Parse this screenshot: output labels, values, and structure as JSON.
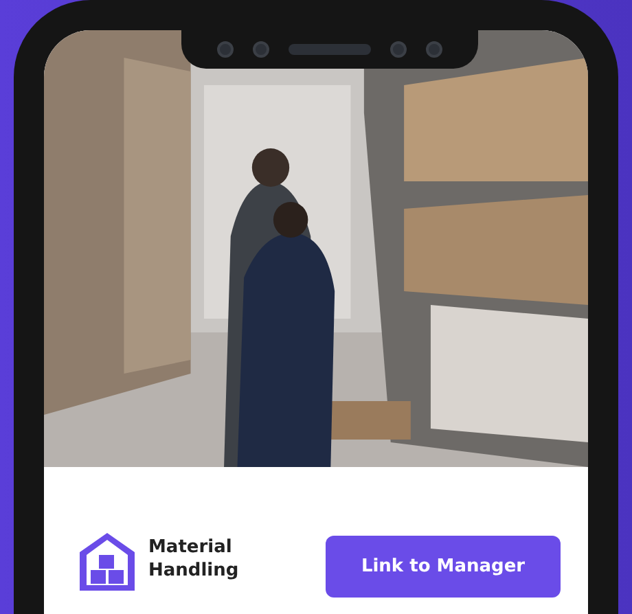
{
  "card": {
    "title": "Material Handling",
    "button": {
      "label": "Link to Manager"
    }
  }
}
